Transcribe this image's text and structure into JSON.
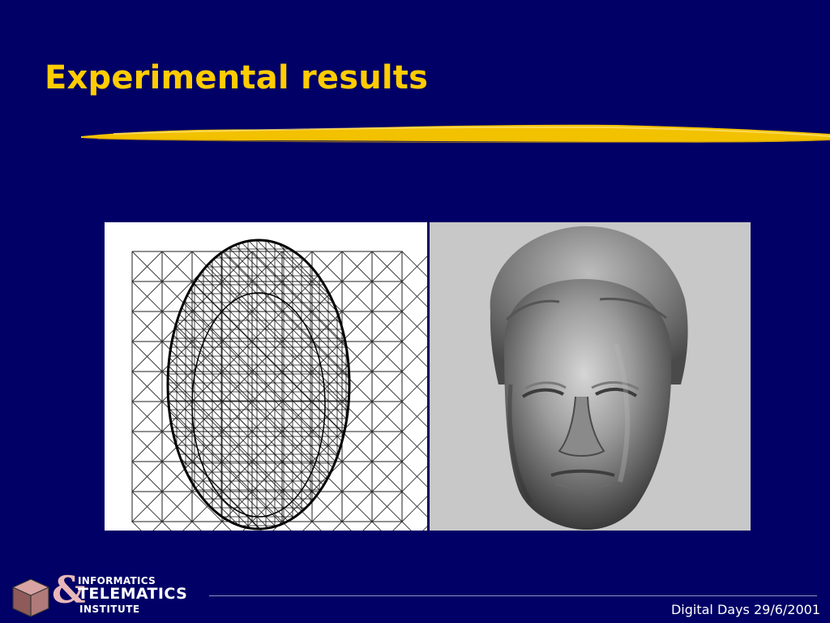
{
  "slide": {
    "title": "Experimental results",
    "footer": "Digital Days 29/6/2001"
  },
  "logo": {
    "symbol": "&",
    "line1": "INFORMATICS",
    "line2": "TELEMATICS",
    "line3": "INSTITUTE",
    "icon": "cube-icon"
  },
  "images": {
    "left": "wireframe-face-mesh",
    "right": "shaded-face-render"
  },
  "colors": {
    "background": "#000066",
    "title": "#ffcc00",
    "underline": "#f2c100",
    "footer_text": "#ffffff",
    "logo_text": "#ffffff",
    "logo_amp": "#e8b8b8"
  }
}
